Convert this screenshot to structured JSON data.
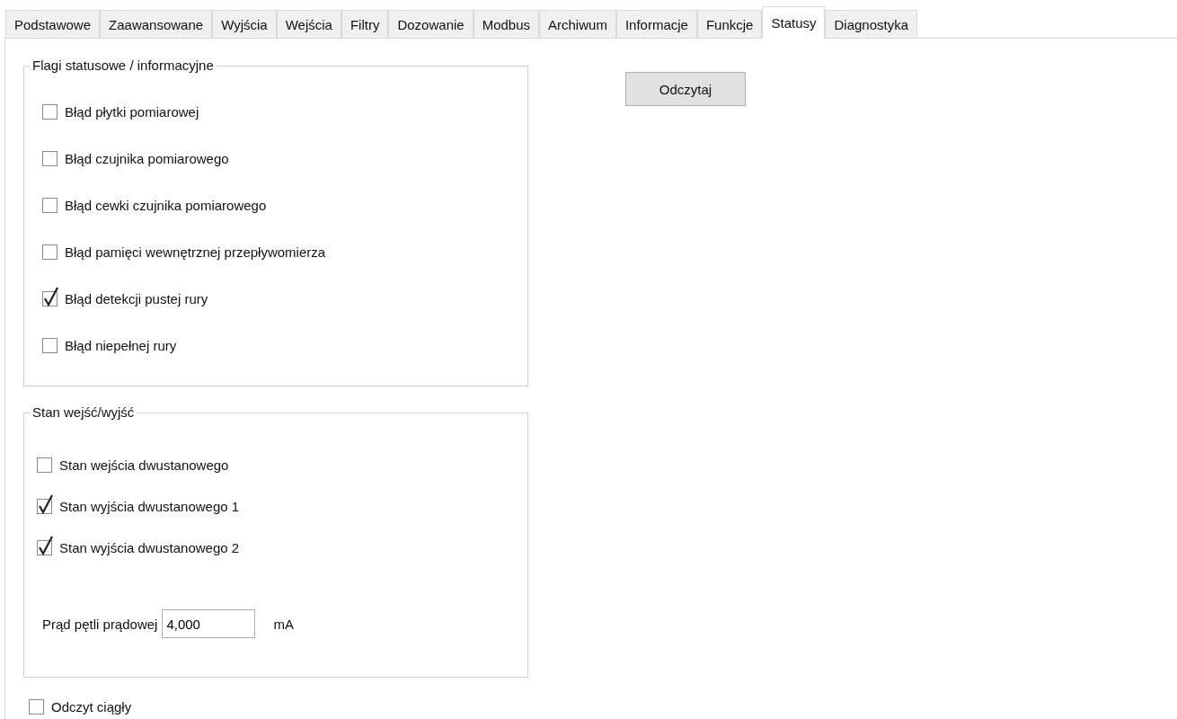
{
  "tabs": [
    {
      "label": "Podstawowe",
      "selected": false
    },
    {
      "label": "Zaawansowane",
      "selected": false
    },
    {
      "label": "Wyjścia",
      "selected": false
    },
    {
      "label": "Wejścia",
      "selected": false
    },
    {
      "label": "Filtry",
      "selected": false
    },
    {
      "label": "Dozowanie",
      "selected": false
    },
    {
      "label": "Modbus",
      "selected": false
    },
    {
      "label": "Archiwum",
      "selected": false
    },
    {
      "label": "Informacje",
      "selected": false
    },
    {
      "label": "Funkcje",
      "selected": false
    },
    {
      "label": "Statusy",
      "selected": true
    },
    {
      "label": "Diagnostyka",
      "selected": false
    }
  ],
  "status_flags": {
    "title": "Flagi statusowe / informacyjne",
    "items": [
      {
        "label": "Błąd płytki pomiarowej",
        "checked": false
      },
      {
        "label": "Błąd czujnika pomiarowego",
        "checked": false
      },
      {
        "label": "Błąd cewki czujnika pomiarowego",
        "checked": false
      },
      {
        "label": "Błąd pamięci wewnętrznej przepływomierza",
        "checked": false
      },
      {
        "label": "Błąd detekcji pustej rury",
        "checked": true
      },
      {
        "label": "Błąd niepełnej rury",
        "checked": false
      }
    ]
  },
  "io_state": {
    "title": "Stan wejść/wyjść",
    "items": [
      {
        "label": "Stan wejścia dwustanowego",
        "checked": false
      },
      {
        "label": "Stan wyjścia dwustanowego 1",
        "checked": true
      },
      {
        "label": "Stan wyjścia dwustanowego 2",
        "checked": true
      }
    ],
    "current": {
      "label": "Prąd pętli prądowej",
      "value": "4,000",
      "unit": "mA"
    }
  },
  "continuous_read": {
    "label": "Odczyt ciągły",
    "checked": false
  },
  "read_button": "Odczytaj"
}
